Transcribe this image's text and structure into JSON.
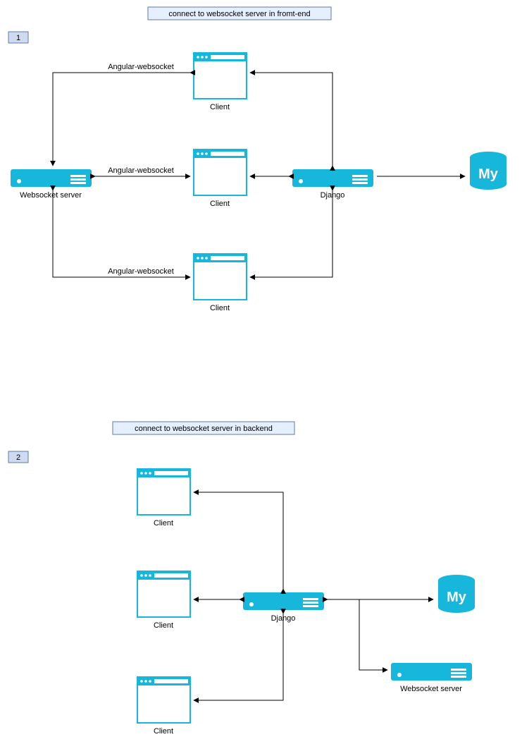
{
  "colors": {
    "accent": "#17b6db",
    "titleFill": "#e6efff",
    "titleBorder": "#5d7ba8",
    "numFill": "#cddaf0"
  },
  "section1": {
    "title": "connect to websocket server in fromt-end",
    "number": "1",
    "nodes": {
      "websocket": "Websocket server",
      "django": "Django",
      "client": "Client",
      "mysql": "My"
    },
    "edges": {
      "angular": "Angular-websocket"
    }
  },
  "section2": {
    "title": "connect to websocket server in backend",
    "number": "2",
    "nodes": {
      "django": "Django",
      "websocket": "Websocket server",
      "client": "Client",
      "mysql": "My"
    }
  }
}
